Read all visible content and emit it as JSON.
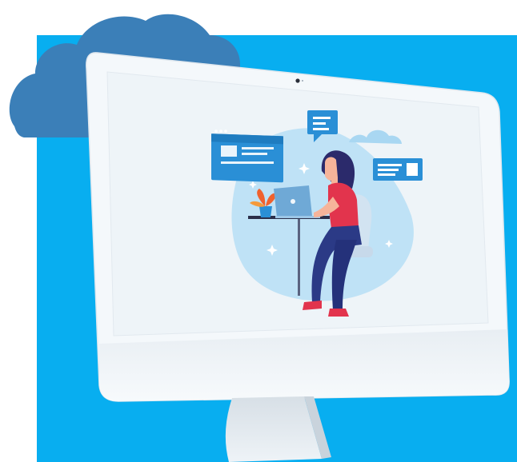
{
  "colors": {
    "backdrop": "#08aef0",
    "cloud": "#3b7fb8",
    "monitor_frame": "#f3f7fb",
    "screen": "#eef4f8",
    "blob": "#bfe2f6",
    "accent_blue": "#2a8fd6",
    "shirt": "#e2344d",
    "pants": "#2b3a86",
    "hair": "#2b2a6b",
    "plant": "#f0612e"
  },
  "icons": [
    "cloud-icon",
    "browser-window-icon",
    "chat-bubble-icon",
    "message-card-icon",
    "laptop-icon",
    "plant-icon",
    "person-at-desk-icon"
  ]
}
